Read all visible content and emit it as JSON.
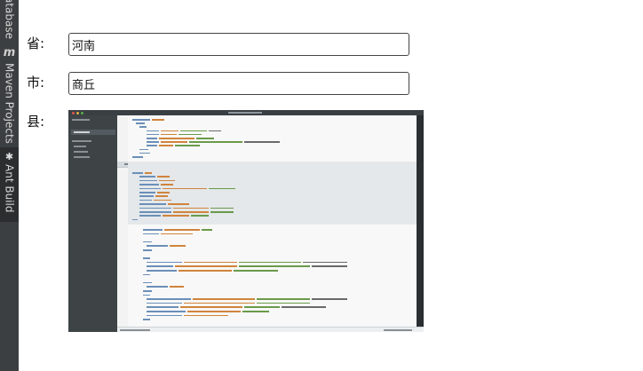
{
  "ide_sidebar": {
    "tabs": [
      {
        "label": "atabase",
        "icon": ""
      },
      {
        "label": "Maven Projects",
        "icon": "maven-m-icon"
      },
      {
        "label": "Ant Build",
        "icon": "ant-icon"
      }
    ]
  },
  "form": {
    "province": {
      "label": "省:",
      "value": "河南"
    },
    "city": {
      "label": "市:",
      "value": "商丘"
    },
    "county": {
      "label": "县:"
    }
  },
  "preview": {
    "description_icon": "code-editor-screenshot",
    "colors": {
      "frame": "#2d3135",
      "sidebar": "#3e4346",
      "editor": "#f8f8f8",
      "inline": "#e4e8ea",
      "tag": "#6b8fb8",
      "attr": "#d1843c",
      "string": "#6a9a4a",
      "text": "#6a6a6a"
    }
  }
}
